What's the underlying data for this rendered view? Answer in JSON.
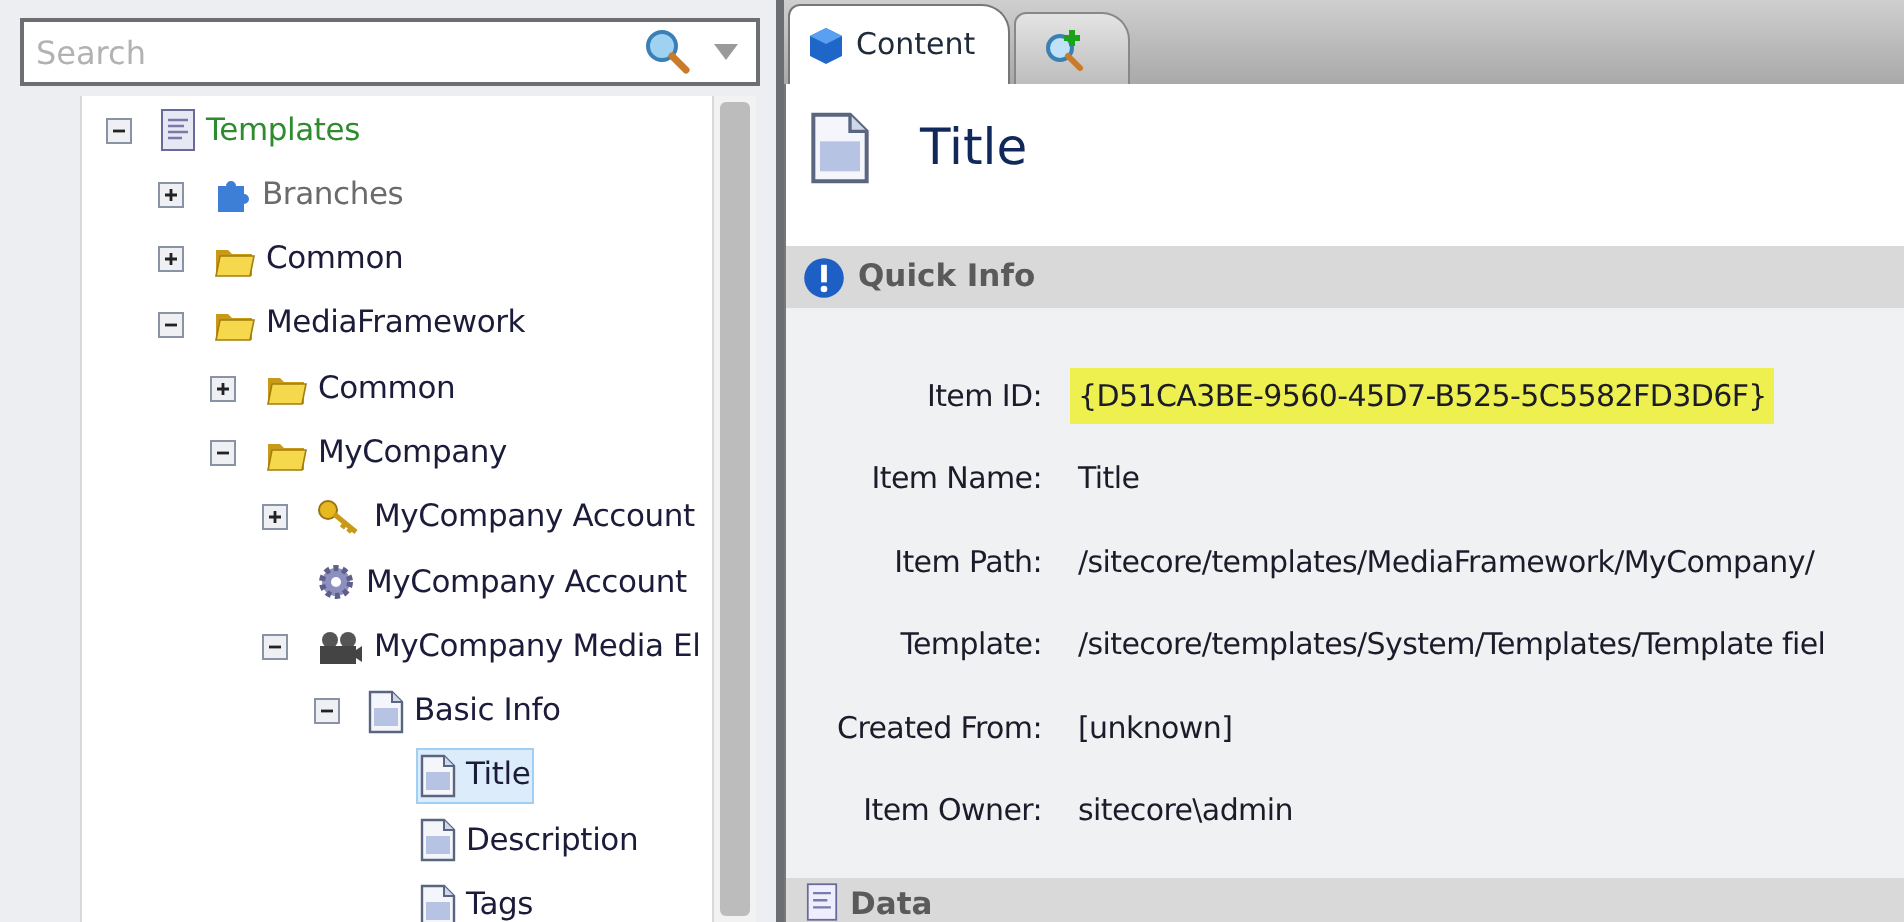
{
  "search": {
    "placeholder": "Search"
  },
  "tree": [
    {
      "label": "Templates",
      "kind": "template",
      "color": "#2e8b2e",
      "expanded": true,
      "selected": false,
      "children": [
        {
          "label": "Branches",
          "kind": "puzzle",
          "color": "#6b6b6b",
          "expanded": false,
          "selected": false
        },
        {
          "label": "Common",
          "kind": "folder",
          "color": "#1b1b3a",
          "expanded": false,
          "selected": false
        },
        {
          "label": "MediaFramework",
          "kind": "folder",
          "color": "#1b1b3a",
          "expanded": true,
          "selected": false,
          "children": [
            {
              "label": "Common",
              "kind": "folder",
              "color": "#1b1b3a",
              "expanded": false,
              "selected": false
            },
            {
              "label": "MyCompany",
              "kind": "folder",
              "color": "#1b1b3a",
              "expanded": true,
              "selected": false,
              "children": [
                {
                  "label": "MyCompany Account",
                  "kind": "key",
                  "color": "#1b1b3a",
                  "expanded": false,
                  "selected": false
                },
                {
                  "label": "MyCompany Account",
                  "kind": "gear",
                  "color": "#1b1b3a",
                  "selected": false
                },
                {
                  "label": "MyCompany Media El",
                  "kind": "film",
                  "color": "#1b1b3a",
                  "expanded": true,
                  "selected": false,
                  "children": [
                    {
                      "label": "Basic Info",
                      "kind": "document",
                      "color": "#1b1b3a",
                      "expanded": true,
                      "selected": false,
                      "children": [
                        {
                          "label": "Title",
                          "kind": "document",
                          "color": "#1b1b3a",
                          "selected": true
                        },
                        {
                          "label": "Description",
                          "kind": "document",
                          "color": "#1b1b3a",
                          "selected": false
                        },
                        {
                          "label": "Tags",
                          "kind": "document",
                          "color": "#1b1b3a",
                          "selected": false
                        }
                      ]
                    }
                  ]
                }
              ]
            }
          ]
        }
      ]
    }
  ],
  "tabs": [
    {
      "kind": "text",
      "label": "Content",
      "selected": true
    },
    {
      "kind": "icon",
      "selected": false
    }
  ],
  "header": {
    "title": "Title"
  },
  "quick_info": {
    "title": "Quick Info",
    "fields": [
      {
        "label": "Item ID:",
        "value": "{D51CA3BE-9560-45D7-B525-5C5582FD3D6F}",
        "highlighted": true
      },
      {
        "label": "Item Name:",
        "value": "Title",
        "highlighted": false
      },
      {
        "label": "Item Path:",
        "value": "/sitecore/templates/MediaFramework/MyCompany/",
        "highlighted": false
      },
      {
        "label": "Template:",
        "value": "/sitecore/templates/System/Templates/Template fiel",
        "highlighted": false
      },
      {
        "label": "Created From:",
        "value": "[unknown]",
        "highlighted": false
      },
      {
        "label": "Item Owner:",
        "value": "sitecore\\admin",
        "highlighted": false
      }
    ]
  },
  "data_section": {
    "title": "Data"
  }
}
